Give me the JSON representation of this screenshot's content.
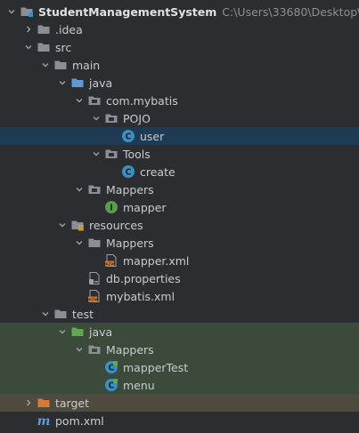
{
  "tree": {
    "project": {
      "name": "StudentManagementSystem",
      "path": "C:\\Users\\33680\\Desktop\\Stude"
    },
    "idea": ".idea",
    "src": "src",
    "main": "main",
    "java": "java",
    "com_mybatis": "com.mybatis",
    "pojo": "POJO",
    "user": "user",
    "tools": "Tools",
    "create": "create",
    "mappers_pkg": "Mappers",
    "mapper": "mapper",
    "resources": "resources",
    "res_mappers": "Mappers",
    "mapper_xml": "mapper.xml",
    "db_properties": "db.properties",
    "mybatis_xml": "mybatis.xml",
    "test": "test",
    "test_java": "java",
    "test_mappers": "Mappers",
    "mapper_test": "mapperTest",
    "menu": "menu",
    "target": "target",
    "pom": "pom.xml"
  },
  "colors": {
    "folder": "#8b8e94",
    "source_folder": "#5b9bd8",
    "test_folder": "#5fa84c",
    "excluded_folder": "#d9793a",
    "class_icon": "#3592c4",
    "interface_icon": "#5a9c4a",
    "xml_icon": "#cc7832",
    "selection": "#1f3a53"
  }
}
